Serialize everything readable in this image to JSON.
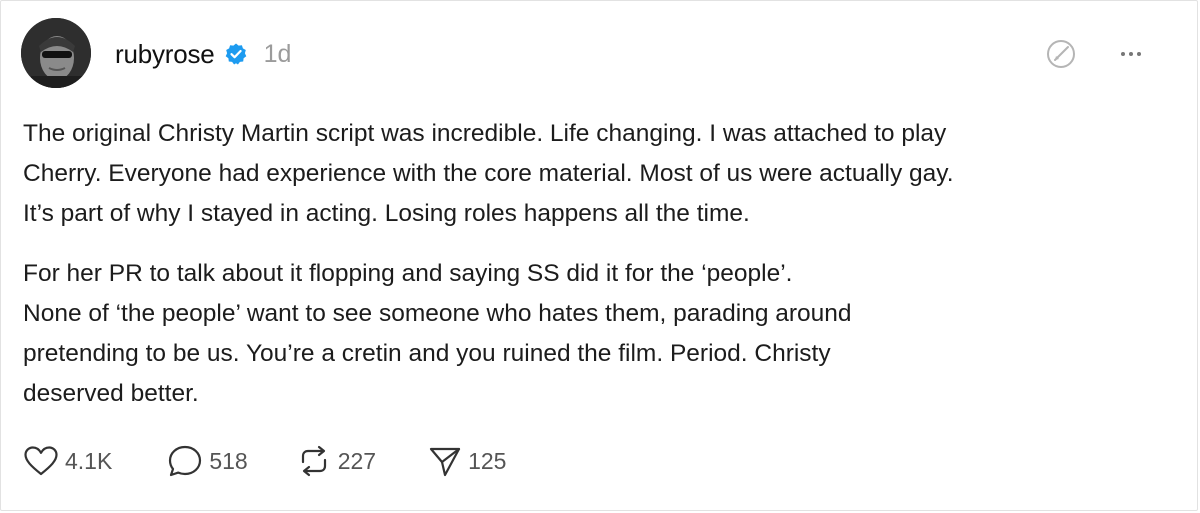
{
  "post": {
    "username": "rubyrose",
    "timestamp": "1d",
    "paragraph1_lines": [
      "The original Christy Martin script was incredible. Life changing. I was attached to play",
      "Cherry. Everyone had experience with the core material. Most of us were actually gay.",
      "It’s part of why I stayed in acting. Losing roles happens all the time."
    ],
    "paragraph2_lines": [
      "For her PR to talk about it flopping and saying SS did it for the ‘people’.",
      "None of ‘the people’ want to see someone who hates them, parading around",
      "pretending to be us. You’re a cretin and you ruined the film. Period. Christy",
      "deserved better."
    ]
  },
  "actions": {
    "likes": "4.1K",
    "replies": "518",
    "reposts": "227",
    "shares": "125"
  },
  "icons": {
    "verified": "verified-badge-icon",
    "edit": "edit-circle-icon",
    "more": "more-options-icon",
    "like": "heart-icon",
    "reply": "comment-bubble-icon",
    "repost": "repost-arrows-icon",
    "share": "send-paper-plane-icon"
  },
  "colors": {
    "verified": "#1d9bf0",
    "text": "#1c1c1c",
    "muted": "#9b9b9b"
  }
}
